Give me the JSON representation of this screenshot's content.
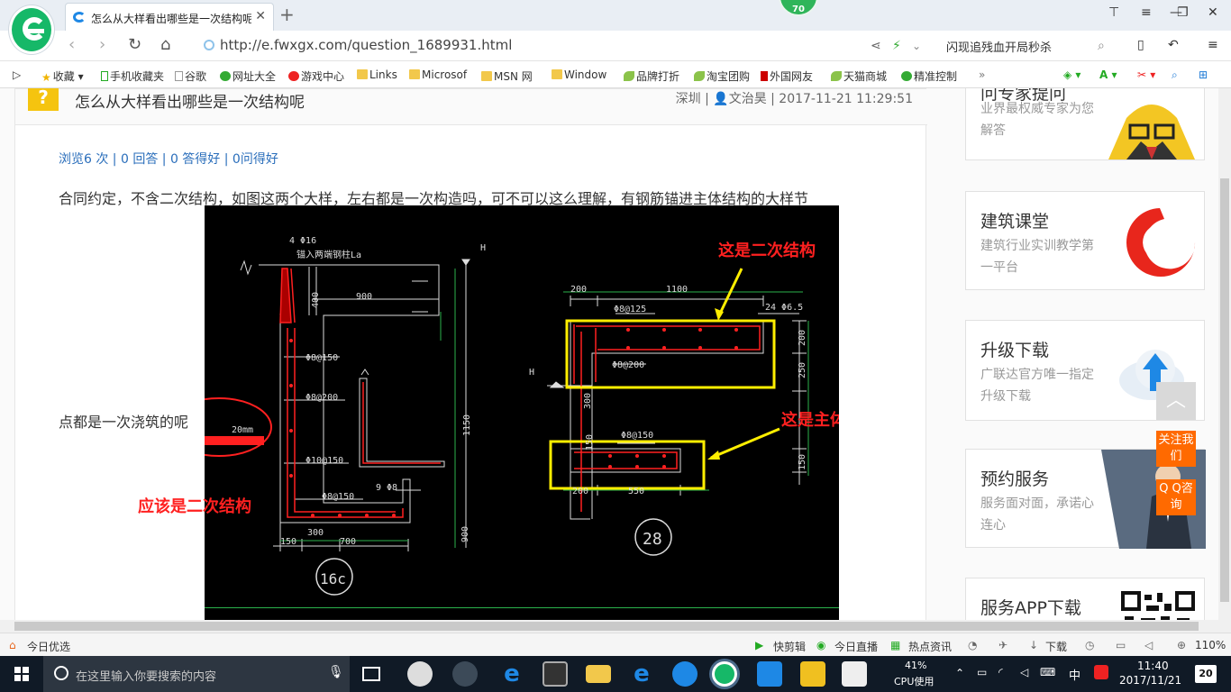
{
  "browser": {
    "tab_title": "怎么从大样看出哪些是一次结构呢",
    "close_glyph": "✕",
    "new_tab_glyph": "+",
    "notification_count": "70",
    "url": "http://e.fwxgx.com/question_1689931.html",
    "hot_search": "闪现追残血开局秒杀",
    "zoom": "110%"
  },
  "bookmarks": [
    {
      "label": "收藏",
      "icon": "star-icon"
    },
    {
      "label": "手机收藏夹",
      "icon": "phone-icon"
    },
    {
      "label": "谷歌",
      "icon": "page-icon"
    },
    {
      "label": "网址大全",
      "icon": "web-icon"
    },
    {
      "label": "游戏中心",
      "icon": "game-icon"
    },
    {
      "label": "Links",
      "icon": "folder-icon"
    },
    {
      "label": "Microsof",
      "icon": "folder-icon"
    },
    {
      "label": "MSN 网",
      "icon": "folder-icon"
    },
    {
      "label": "Window",
      "icon": "folder-icon"
    },
    {
      "label": "品牌打折",
      "icon": "leaf-icon"
    },
    {
      "label": "淘宝团购",
      "icon": "leaf-icon"
    },
    {
      "label": "外国网友",
      "icon": "bookmark-icon"
    },
    {
      "label": "天猫商城",
      "icon": "leaf-icon"
    },
    {
      "label": "精准控制",
      "icon": "chat-icon"
    }
  ],
  "question": {
    "icon_text": "?",
    "title": "怎么从大样看出哪些是一次结构呢",
    "meta": "深圳 | 👤文治昊 | 2017-11-21 11:29:51",
    "stats": "浏览6 次 | 0 回答 | 0 答得好 | 0问得好",
    "body_line1": "合同约定，不含二次结构，如图这两个大样，左右都是一次构造吗，可不可以这么理解，有钢筋锚进主体结构的大样节",
    "body_line2": "点都是一次浇筑的呢"
  },
  "cad": {
    "annot_top": "这是二次结构",
    "annot_mid": "这是主体结构要求一起浇筑",
    "annot_left": "应该是二次结构",
    "label_16c": "16c",
    "label_28": "28",
    "dims_left": [
      "4 Φ16",
      "锚入两端钢柱La",
      "900",
      "400",
      "Φ8@150",
      "Φ8@200",
      "Φ10@150",
      "Φ8@150",
      "9 Φ8",
      "300",
      "700",
      "150",
      "1150",
      "900",
      "H",
      "20mm"
    ],
    "dims_right": [
      "200",
      "1100",
      "24 Φ6.5",
      "Φ8@125",
      "Φ8@200",
      "Φ8@150",
      "200",
      "250",
      "300",
      "150",
      "150",
      "200",
      "550",
      "H"
    ]
  },
  "sidebar": [
    {
      "title": "问专家提问",
      "sub": "业界最权威专家为您解答",
      "icon": "expert-mascot-icon"
    },
    {
      "title": "建筑课堂",
      "sub": "建筑行业实训教学第一平台",
      "icon": "red-swirl-logo-icon"
    },
    {
      "title": "升级下载",
      "sub": "广联达官方唯一指定升级下载",
      "icon": "cloud-upload-icon"
    },
    {
      "title": "预约服务",
      "sub": "服务面对面，承诺心连心",
      "icon": "service-photo-icon"
    },
    {
      "title": "服务APP下载",
      "sub": "",
      "icon": "qr-code-icon"
    }
  ],
  "float_buttons": {
    "top_glyph": "︿",
    "follow": "关注我们",
    "qq": "Q Q咨询"
  },
  "statusbar": {
    "left": "今日优选",
    "items": [
      "快剪辑",
      "今日直播",
      "热点资讯",
      "下载"
    ]
  },
  "taskbar": {
    "search_placeholder": "在这里输入你要搜索的内容",
    "cpu_percent": "41%",
    "cpu_label": "CPU使用",
    "ime": "中",
    "time": "11:40",
    "date": "2017/11/21",
    "notifications": "20"
  },
  "colors": {
    "accent_green": "#16b868",
    "link_blue": "#2a6ebb",
    "annot_red": "#ff2020",
    "box_yellow": "#ffee00",
    "float_orange": "#ff6a00"
  }
}
